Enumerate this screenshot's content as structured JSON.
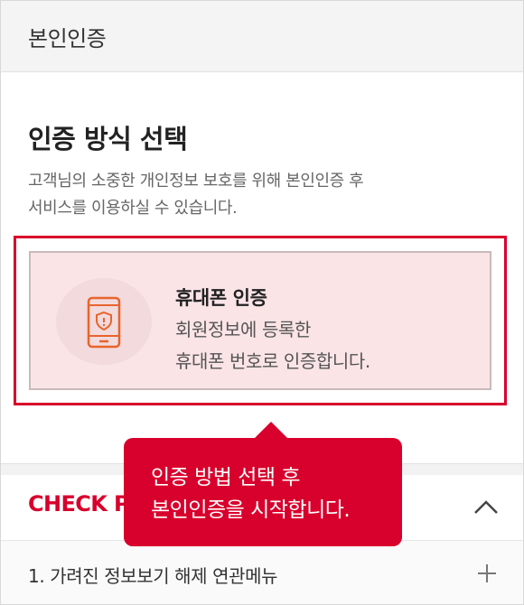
{
  "header": {
    "title": "본인인증"
  },
  "main": {
    "title": "인증 방식 선택",
    "desc_line1": "고객님의 소중한 개인정보 보호를 위해 본인인증 후",
    "desc_line2": "서비스를 이용하실 수 있습니다."
  },
  "card": {
    "title": "휴대폰 인증",
    "desc_line1": "회원정보에 등록한",
    "desc_line2": "휴대폰 번호로 인증합니다.",
    "icon": "phone-shield-icon"
  },
  "check": {
    "title": "CHECK P",
    "toggle_icon": "chevron-up-icon"
  },
  "menu": {
    "item1": "1. 가려진 정보보기 해제 연관메뉴",
    "expand_icon": "plus-icon"
  },
  "tooltip": {
    "line1": "인증 방법 선택 후",
    "line2": "본인인증을 시작합니다."
  },
  "colors": {
    "accent": "#d8002c",
    "card_bg": "#fbe4e6",
    "icon": "#e8642c"
  }
}
